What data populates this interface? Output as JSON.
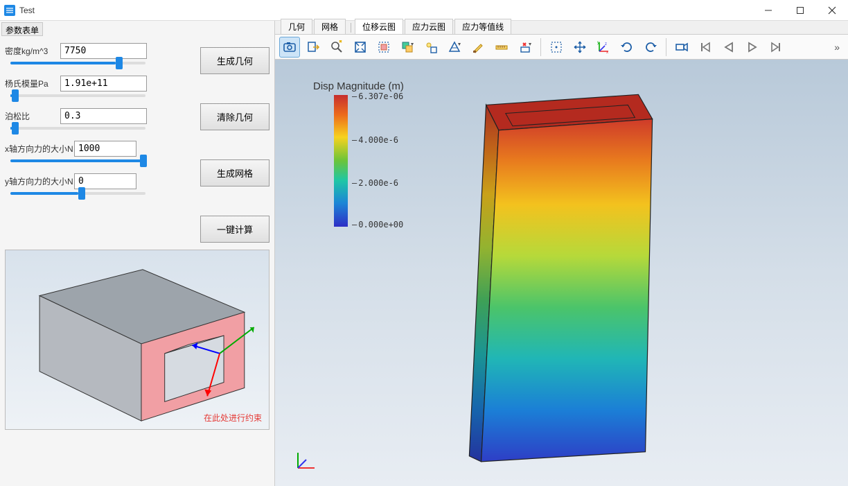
{
  "window": {
    "title": "Test"
  },
  "sidebar": {
    "header": "参数表单"
  },
  "params": {
    "density": {
      "label": "密度kg/m^3",
      "value": "7750",
      "slider_pct": 78
    },
    "youngs": {
      "label": "杨氏模量Pa",
      "value": "1.91e+11",
      "slider_pct": 1
    },
    "poisson": {
      "label": "泊松比",
      "value": "0.3",
      "slider_pct": 1
    },
    "force_x": {
      "label": "x轴方向力的大小N",
      "value": "1000",
      "slider_pct": 99
    },
    "force_y": {
      "label": "y轴方向力的大小N",
      "value": "0",
      "slider_pct": 50
    }
  },
  "buttons": {
    "gen_geom": "生成几何",
    "clear_geom": "清除几何",
    "gen_mesh": "生成网格",
    "one_click": "一键计算"
  },
  "preview": {
    "constraint_note": "在此处进行约束"
  },
  "tabs": {
    "geom": "几何",
    "mesh": "网格",
    "disp": "位移云图",
    "stress_cloud": "应力云图",
    "stress_contour": "应力等值线"
  },
  "legend": {
    "title": "Disp Magnitude (m)",
    "ticks": [
      "6.307e-06",
      "4.000e-6",
      "2.000e-6",
      "0.000e+00"
    ]
  },
  "toolbar_more": "»",
  "colors": {
    "accent": "#1e88e5"
  }
}
